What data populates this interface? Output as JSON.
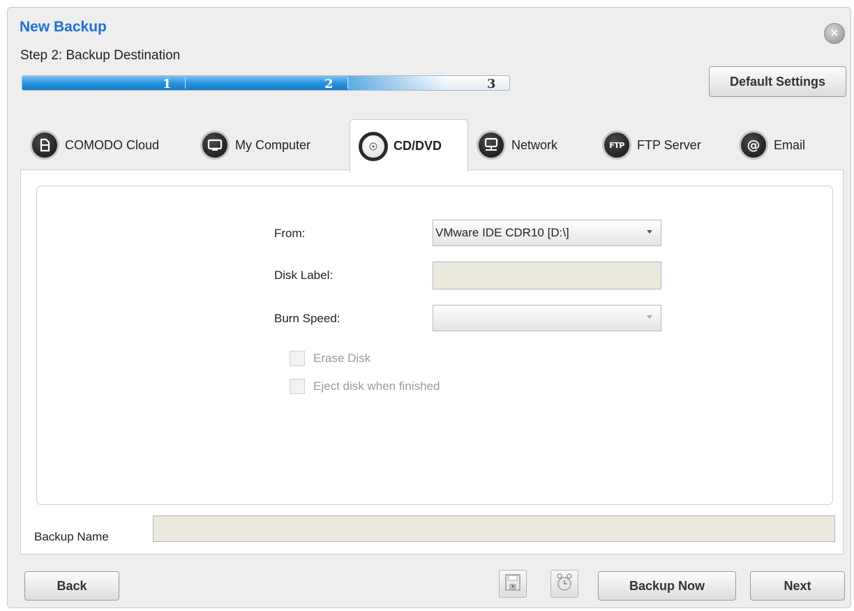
{
  "header": {
    "title": "New Backup",
    "step_text": "Step 2: Backup Destination",
    "default_settings_label": "Default Settings"
  },
  "progress": {
    "steps": [
      "1",
      "2",
      "3"
    ],
    "current_step": 2,
    "total_steps": 3
  },
  "tabs": [
    {
      "label": "COMODO Cloud",
      "icon": "cloud-drive-icon",
      "active": false
    },
    {
      "label": "My Computer",
      "icon": "monitor-icon",
      "active": false
    },
    {
      "label": "CD/DVD",
      "icon": "disc-icon",
      "active": true
    },
    {
      "label": "Network",
      "icon": "network-icon",
      "active": false
    },
    {
      "label": "FTP Server",
      "icon": "ftp-icon",
      "active": false
    },
    {
      "label": "Email",
      "icon": "at-sign-icon",
      "active": false
    }
  ],
  "form": {
    "from_label": "From:",
    "from_value": "VMware IDE CDR10 [D:\\]",
    "disk_label_label": "Disk Label:",
    "disk_label_value": "",
    "burn_speed_label": "Burn Speed:",
    "burn_speed_value": "",
    "erase_disk_label": "Erase Disk",
    "eject_disk_label": "Eject disk when finished"
  },
  "backup_name": {
    "label": "Backup Name",
    "value": ""
  },
  "footer": {
    "back_label": "Back",
    "backup_now_label": "Backup Now",
    "next_label": "Next"
  },
  "colors": {
    "title": "#1d6fd6",
    "progress_fill": "#2b93dc",
    "input_bg": "#ece9dd"
  }
}
